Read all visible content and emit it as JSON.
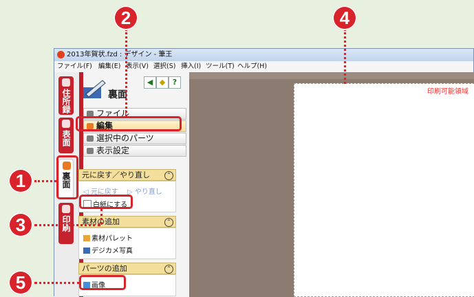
{
  "window": {
    "title": "2013年賀状.fzd : デザイン - 筆王"
  },
  "menubar": [
    "ファイル(F)",
    "編集(E)",
    "表示(V)",
    "選択(S)",
    "挿入(I)",
    "ツール(T)",
    "ヘルプ(H)"
  ],
  "tabs": [
    {
      "label": "住所録",
      "color": "#c4232e"
    },
    {
      "label": "表面",
      "color": "#c4232e"
    },
    {
      "label": "裏面",
      "color": "#ffffff",
      "active": true
    },
    {
      "label": "印刷",
      "color": "#c4232e"
    }
  ],
  "panel": {
    "title": "裏面",
    "sections": [
      "ファイル",
      "編集",
      "選択中のパーツ",
      "表示設定"
    ],
    "active_section": "編集",
    "groups": [
      {
        "title": "元に戻す／やり直し",
        "items": [
          "元に戻す",
          "やり直し",
          "白紙にする"
        ]
      },
      {
        "title": "素材の追加",
        "items": [
          "素材パレット",
          "デジカメ写真"
        ]
      },
      {
        "title": "パーツの追加",
        "items": [
          "画像"
        ]
      }
    ]
  },
  "canvas": {
    "print_area_label": "印刷可能領域"
  },
  "callouts": [
    "1",
    "2",
    "3",
    "4",
    "5"
  ],
  "colors": {
    "callout": "#d8232a",
    "accent": "#c4232e",
    "group_header": "#f3df9b"
  }
}
